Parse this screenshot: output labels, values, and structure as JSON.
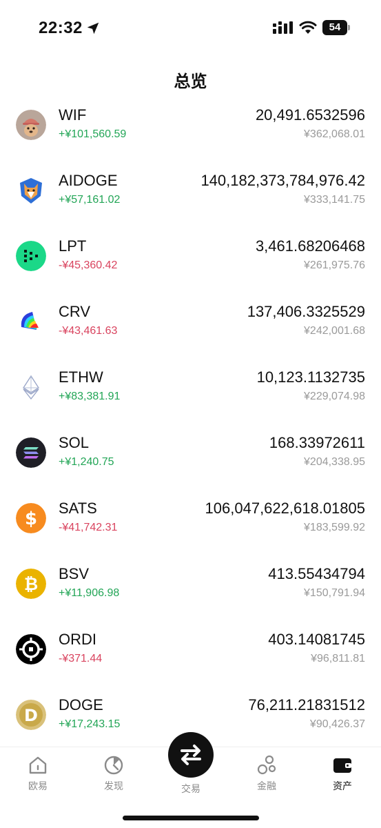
{
  "status_bar": {
    "time": "22:32",
    "battery": "54"
  },
  "header": {
    "title": "总览"
  },
  "assets": [
    {
      "symbol": "WIF",
      "pnl": "+¥101,560.59",
      "pnl_sign": "positive",
      "amount": "20,491.6532596",
      "value": "¥362,068.01",
      "icon": "wif-dog-icon"
    },
    {
      "symbol": "AIDOGE",
      "pnl": "+¥57,161.02",
      "pnl_sign": "positive",
      "amount": "140,182,373,784,976.42",
      "value": "¥333,141.75",
      "icon": "aidoge-shiba-icon"
    },
    {
      "symbol": "LPT",
      "pnl": "-¥45,360.42",
      "pnl_sign": "negative",
      "amount": "3,461.68206468",
      "value": "¥261,975.76",
      "icon": "lpt-livepeer-icon"
    },
    {
      "symbol": "CRV",
      "pnl": "-¥43,461.63",
      "pnl_sign": "negative",
      "amount": "137,406.3325529",
      "value": "¥242,001.68",
      "icon": "crv-curve-icon"
    },
    {
      "symbol": "ETHW",
      "pnl": "+¥83,381.91",
      "pnl_sign": "positive",
      "amount": "10,123.1132735",
      "value": "¥229,074.98",
      "icon": "ethw-diamond-icon"
    },
    {
      "symbol": "SOL",
      "pnl": "+¥1,240.75",
      "pnl_sign": "positive",
      "amount": "168.33972611",
      "value": "¥204,338.95",
      "icon": "sol-solana-icon"
    },
    {
      "symbol": "SATS",
      "pnl": "-¥41,742.31",
      "pnl_sign": "negative",
      "amount": "106,047,622,618.01805",
      "value": "¥183,599.92",
      "icon": "sats-dollar-icon"
    },
    {
      "symbol": "BSV",
      "pnl": "+¥11,906.98",
      "pnl_sign": "positive",
      "amount": "413.55434794",
      "value": "¥150,791.94",
      "icon": "bsv-bitcoin-icon"
    },
    {
      "symbol": "ORDI",
      "pnl": "-¥371.44",
      "pnl_sign": "negative",
      "amount": "403.14081745",
      "value": "¥96,811.81",
      "icon": "ordi-icon"
    },
    {
      "symbol": "DOGE",
      "pnl": "+¥17,243.15",
      "pnl_sign": "positive",
      "amount": "76,211.21831512",
      "value": "¥90,426.37",
      "icon": "doge-icon"
    }
  ],
  "tabs": [
    {
      "label": "欧易",
      "icon": "home-icon"
    },
    {
      "label": "发现",
      "icon": "discover-icon"
    },
    {
      "label": "交易",
      "icon": "swap-arrows-icon"
    },
    {
      "label": "金融",
      "icon": "finance-bubbles-icon"
    },
    {
      "label": "资产",
      "icon": "wallet-icon",
      "active": true
    }
  ],
  "colors": {
    "positive": "#22a556",
    "negative": "#d9435e",
    "secondary": "#9a9a9a"
  }
}
